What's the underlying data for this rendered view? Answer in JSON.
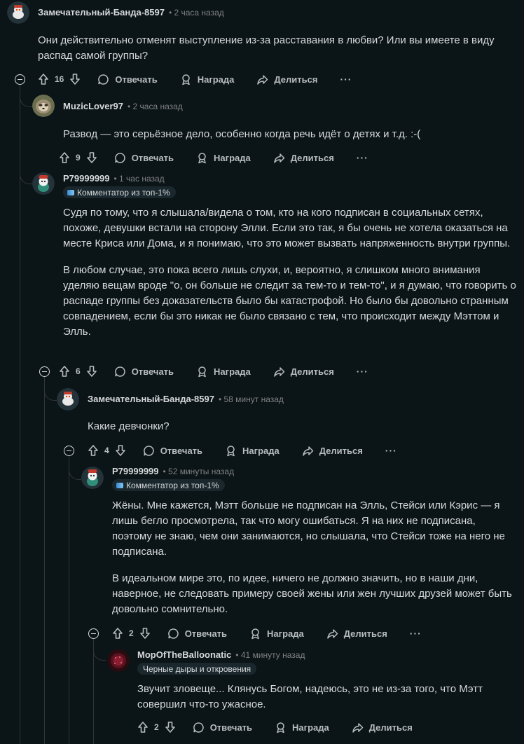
{
  "actions": {
    "reply": "Отвечать",
    "award": "Награда",
    "share": "Делиться",
    "more": "···"
  },
  "comments": [
    {
      "author": "Замечательный-Банда-8597",
      "time": "• 2 часа назад",
      "flair": "",
      "paragraphs": [
        "Они действительно отменят выступление из-за расставания в любви? Или вы имеете в виду распад самой группы?"
      ],
      "votes": "16"
    },
    {
      "author": "MuzicLover97",
      "time": "• 2 часа назад",
      "flair": "",
      "paragraphs": [
        "Развод — это серьёзное дело, особенно когда речь идёт о детях и т.д. :-("
      ],
      "votes": "9"
    },
    {
      "author": "P79999999",
      "time": "• 1 час назад",
      "flair": "Комментатор из топ-1%",
      "paragraphs": [
        "Судя по тому, что я слышала/видела о том, кто на кого подписан в социальных сетях, похоже, девушки встали на сторону Элли. Если это так, я бы очень не хотела оказаться на месте Криса или Дома, и я понимаю, что это может вызвать напряженность внутри группы.",
        "В любом случае, это пока всего лишь слухи, и, вероятно, я слишком много внимания уделяю вещам вроде \"о, он больше не следит за тем-то и тем-то\", и я думаю, что говорить о распаде группы без доказательств было бы катастрофой. Но было бы довольно странным совпадением, если бы это никак не было связано с тем, что происходит между Мэттом и Элль."
      ],
      "votes": "6"
    },
    {
      "author": "Замечательный-Банда-8597",
      "time": "• 58 минут назад",
      "flair": "",
      "paragraphs": [
        "Какие девчонки?"
      ],
      "votes": "4"
    },
    {
      "author": "P79999999",
      "time": "• 52 минуты назад",
      "flair": "Комментатор из топ-1%",
      "paragraphs": [
        "Жёны. Мне кажется, Мэтт больше не подписан на Элль, Стейси или Кэрис — я лишь бегло просмотрела, так что могу ошибаться. Я на них не подписана, поэтому не знаю, чем они занимаются, но слышала, что Стейси тоже на него не подписана.",
        "В идеальном мире это, по идее, ничего не должно значить, но в наши дни, наверное, не следовать примеру своей жены или жен лучших друзей может быть довольно сомнительно."
      ],
      "votes": "2"
    },
    {
      "author": "MopOfTheBalloonatic",
      "time": "• 41 минуту назад",
      "flair": "Черные дыры и откровения",
      "paragraphs": [
        "Звучит зловеще... Клянусь Богом, надеюсь, это не из-за того, что Мэтт совершил что-то ужасное."
      ],
      "votes": "2"
    }
  ]
}
